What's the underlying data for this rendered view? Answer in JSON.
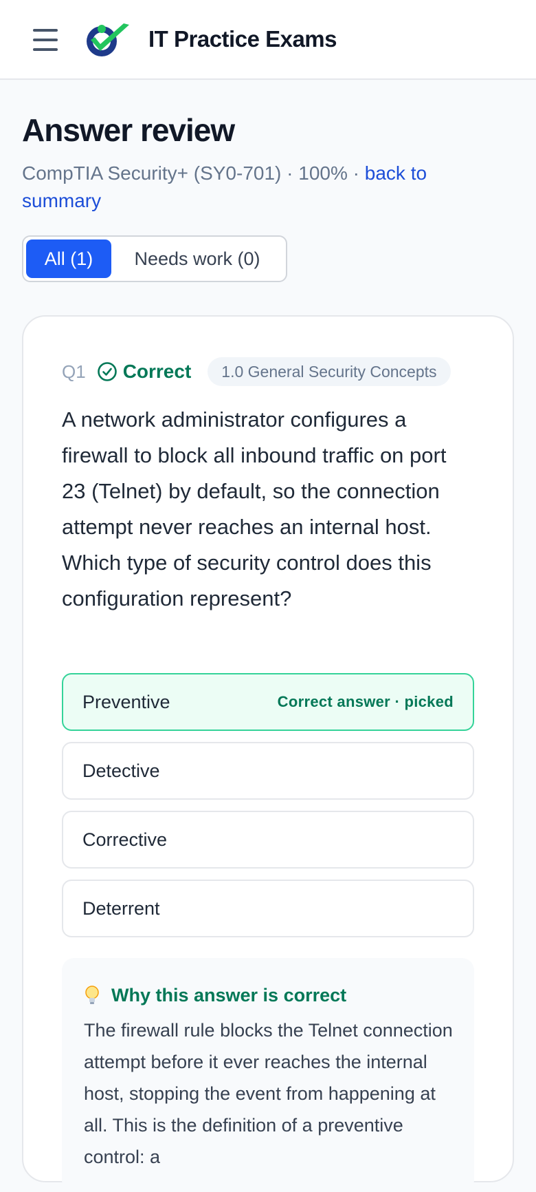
{
  "header": {
    "brand": "IT Practice Exams",
    "menu_icon": "hamburger-menu-icon",
    "logo_icon": "checkmark-person-logo"
  },
  "page": {
    "title": "Answer review",
    "exam": "CompTIA Security+ (SY0-701)",
    "separator": " · ",
    "score": "100%",
    "back_link": "back to summary"
  },
  "filters": {
    "all": "All (1)",
    "needs_work": "Needs work (0)",
    "active": "all"
  },
  "question": {
    "number": "Q1",
    "status": "Correct",
    "domain": "1.0 General Security Concepts",
    "text": "A network administrator configures a firewall to block all inbound traffic on port 23 (Telnet) by default, so the connection attempt never reaches an internal host. Which type of security control does this configuration represent?",
    "options": [
      {
        "label": "Preventive",
        "status": "Correct answer · picked"
      },
      {
        "label": "Detective",
        "status": ""
      },
      {
        "label": "Corrective",
        "status": ""
      },
      {
        "label": "Deterrent",
        "status": ""
      }
    ],
    "explanation_title": "Why this answer is correct",
    "explanation": "The firewall rule blocks the Telnet connection attempt before it ever reaches the internal host, stopping the event from happening at all. This is the definition of a preventive control: a"
  },
  "colors": {
    "accent": "#1d5cf5",
    "correct": "#047857",
    "correct_bg": "#ecfdf5",
    "link": "#1d4ed8"
  }
}
